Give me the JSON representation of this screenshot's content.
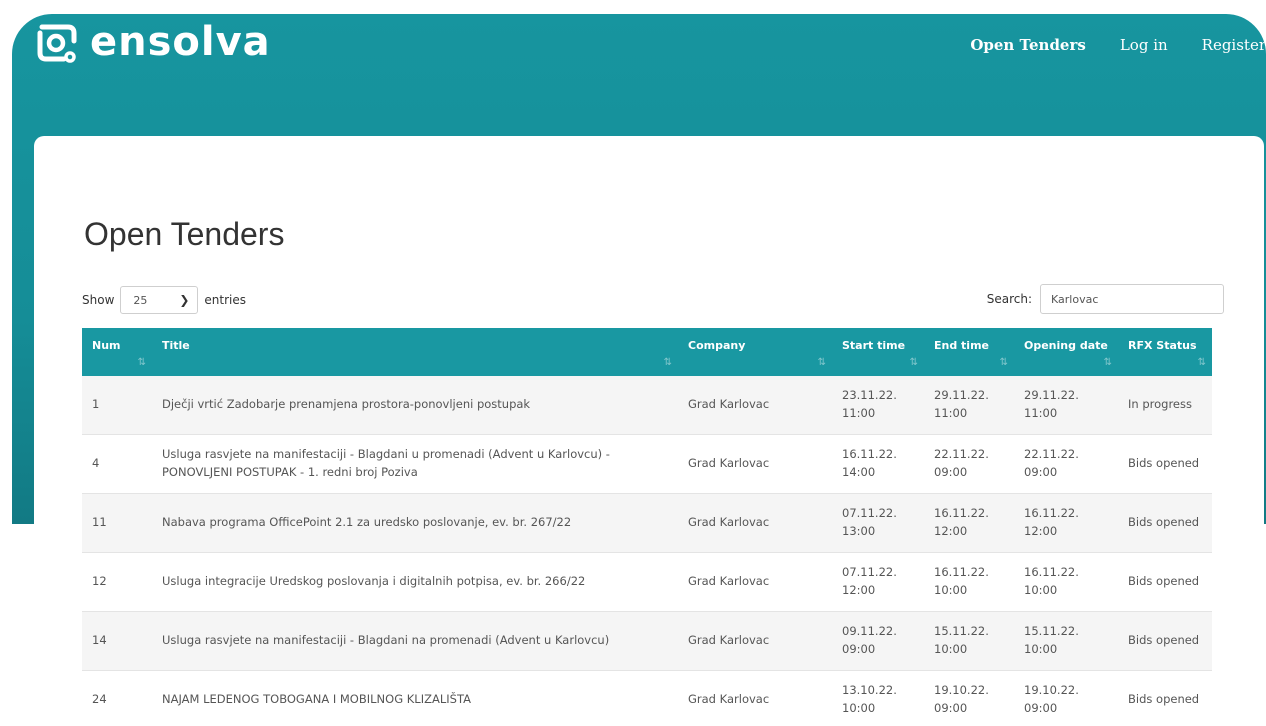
{
  "brand": {
    "name": "ensolva",
    "accent": "#17959f"
  },
  "nav": [
    {
      "label": "Open Tenders",
      "active": true
    },
    {
      "label": "Log in",
      "active": false
    },
    {
      "label": "Register",
      "active": false
    }
  ],
  "page": {
    "title": "Open Tenders"
  },
  "controls": {
    "show_label": "Show",
    "entries_value": "25",
    "entries_label": "entries",
    "search_label": "Search:",
    "search_value": "Karlovac"
  },
  "table": {
    "columns": [
      "Num",
      "Title",
      "Company",
      "Start time",
      "End time",
      "Opening date",
      "RFX Status"
    ],
    "rows": [
      [
        "1",
        "Dječji vrtić Zadobarje prenamjena prostora-ponovljeni postupak",
        "Grad Karlovac",
        "23.11.22. 11:00",
        "29.11.22. 11:00",
        "29.11.22. 11:00",
        "In progress"
      ],
      [
        "4",
        "Usluga rasvjete na manifestaciji - Blagdani u promenadi (Advent u Karlovcu) - PONOVLJENI POSTUPAK - 1. redni broj Poziva",
        "Grad Karlovac",
        "16.11.22. 14:00",
        "22.11.22. 09:00",
        "22.11.22. 09:00",
        "Bids opened"
      ],
      [
        "11",
        "Nabava programa OfficePoint 2.1 za uredsko poslovanje, ev. br. 267/22",
        "Grad Karlovac",
        "07.11.22. 13:00",
        "16.11.22. 12:00",
        "16.11.22. 12:00",
        "Bids opened"
      ],
      [
        "12",
        "Usluga integracije Uredskog poslovanja i digitalnih potpisa, ev. br. 266/22",
        "Grad Karlovac",
        "07.11.22. 12:00",
        "16.11.22. 10:00",
        "16.11.22. 10:00",
        "Bids opened"
      ],
      [
        "14",
        "Usluga rasvjete na manifestaciji - Blagdani na promenadi (Advent u Karlovcu)",
        "Grad Karlovac",
        "09.11.22. 09:00",
        "15.11.22. 10:00",
        "15.11.22. 10:00",
        "Bids opened"
      ],
      [
        "24",
        "NAJAM LEDENOG TOBOGANA I MOBILNOG KLIZALIŠTA",
        "Grad Karlovac",
        "13.10.22. 10:00",
        "19.10.22. 09:00",
        "19.10.22. 09:00",
        "Bids opened"
      ]
    ]
  },
  "icons": {
    "logo": "ensolva-logo-icon",
    "dropdown": "chevron-down-icon",
    "sort": "sort-icon"
  }
}
